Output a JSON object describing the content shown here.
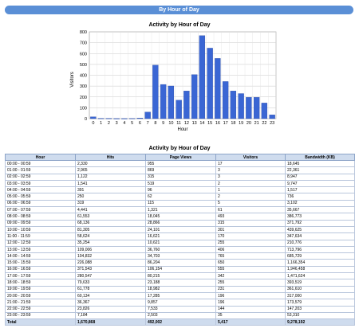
{
  "header": {
    "title": "By Hour of Day"
  },
  "chart_data": {
    "type": "bar",
    "title": "Activity by Hour of Day",
    "xlabel": "Hour",
    "ylabel": "Visitors",
    "ylim": [
      0,
      800
    ],
    "yticks": [
      0,
      100,
      200,
      300,
      400,
      500,
      600,
      700,
      800
    ],
    "grid": true,
    "categories": [
      "0",
      "1",
      "2",
      "3",
      "4",
      "5",
      "6",
      "7",
      "8",
      "9",
      "10",
      "11",
      "12",
      "13",
      "14",
      "15",
      "16",
      "17",
      "18",
      "19",
      "20",
      "21",
      "22",
      "23"
    ],
    "values": [
      17,
      3,
      3,
      1,
      1,
      2,
      5,
      61,
      493,
      315,
      301,
      170,
      255,
      406,
      765,
      650,
      555,
      342,
      255,
      231,
      196,
      196,
      144,
      35
    ],
    "bar_color": "#3a66d4"
  },
  "table": {
    "title": "Activity by Hour of Day",
    "columns": [
      "Hour",
      "Hits",
      "Page Views",
      "Visitors",
      "Bandwidth (KB)"
    ],
    "rows": [
      [
        "00:00 - 00:59",
        "2,330",
        "955",
        "17",
        "18,645"
      ],
      [
        "01:00 - 01:59",
        "2,965",
        "869",
        "3",
        "22,361"
      ],
      [
        "02:00 - 02:59",
        "1,122",
        "315",
        "3",
        "8,947"
      ],
      [
        "03:00 - 03:59",
        "1,541",
        "519",
        "2",
        "9,747"
      ],
      [
        "04:00 - 04:59",
        "391",
        "96",
        "1",
        "1,517"
      ],
      [
        "05:00 - 05:59",
        "250",
        "62",
        "2",
        "736"
      ],
      [
        "06:00 - 06:59",
        "319",
        "115",
        "5",
        "3,102"
      ],
      [
        "07:00 - 07:59",
        "4,441",
        "1,321",
        "61",
        "35,667"
      ],
      [
        "08:00 - 08:59",
        "61,553",
        "18,045",
        "493",
        "386,773"
      ],
      [
        "09:00 - 09:59",
        "68,136",
        "28,866",
        "315",
        "371,792"
      ],
      [
        "10:00 - 10:59",
        "81,305",
        "24,101",
        "301",
        "439,625"
      ],
      [
        "11:00 - 11:59",
        "58,624",
        "16,621",
        "170",
        "347,634"
      ],
      [
        "12:00 - 12:59",
        "35,254",
        "10,621",
        "255",
        "210,776"
      ],
      [
        "13:00 - 13:59",
        "109,006",
        "36,760",
        "406",
        "713,796"
      ],
      [
        "14:00 - 14:59",
        "104,832",
        "34,703",
        "765",
        "685,729"
      ],
      [
        "15:00 - 15:59",
        "226,088",
        "86,204",
        "650",
        "1,166,354"
      ],
      [
        "16:00 - 16:59",
        "371,543",
        "106,154",
        "555",
        "1,946,458"
      ],
      [
        "17:00 - 17:59",
        "280,547",
        "80,215",
        "342",
        "1,471,624"
      ],
      [
        "18:00 - 18:59",
        "79,633",
        "23,188",
        "255",
        "393,519"
      ],
      [
        "19:00 - 19:59",
        "61,778",
        "18,982",
        "231",
        "361,610"
      ],
      [
        "20:00 - 20:59",
        "60,134",
        "17,285",
        "196",
        "317,000"
      ],
      [
        "21:00 - 21:59",
        "36,367",
        "9,857",
        "196",
        "173,579"
      ],
      [
        "22:00 - 22:59",
        "23,826",
        "7,533",
        "144",
        "147,203"
      ],
      [
        "23:00 - 23:59",
        "7,184",
        "2,503",
        "35",
        "53,310"
      ]
    ],
    "total": [
      "Total",
      "1,670,868",
      "492,002",
      "5,417",
      "9,278,192"
    ]
  }
}
